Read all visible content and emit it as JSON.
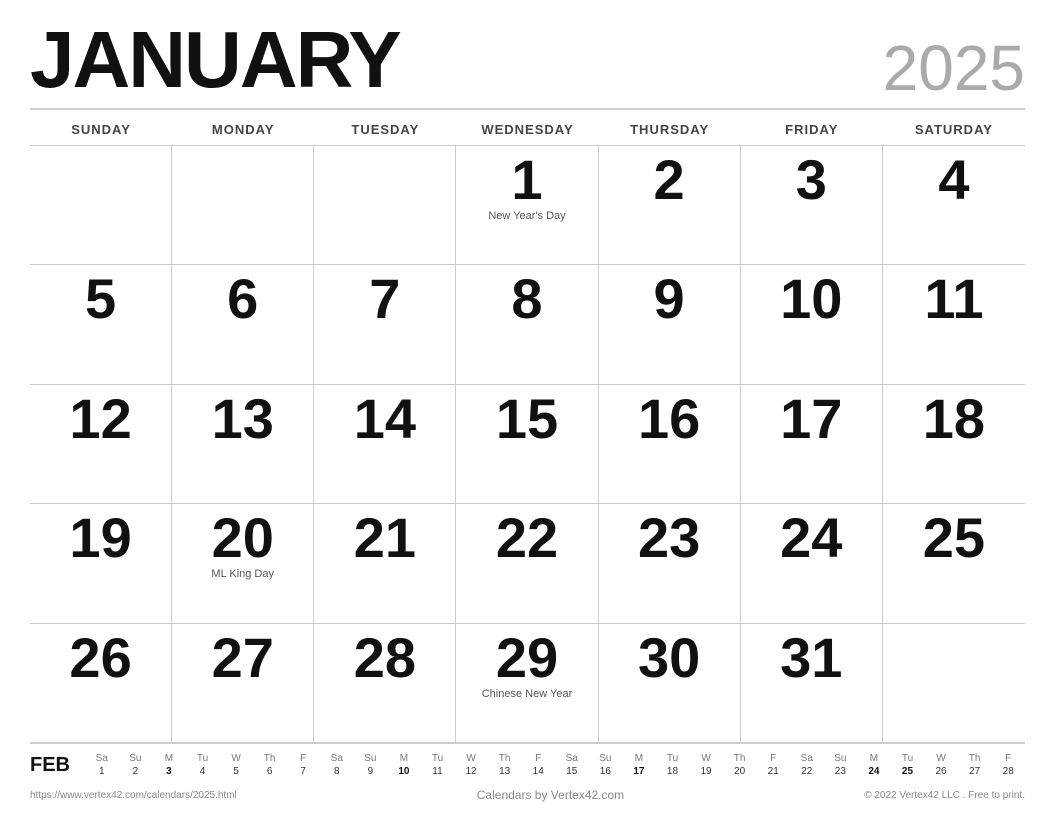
{
  "header": {
    "month": "JANUARY",
    "year": "2025"
  },
  "day_names": [
    "SUNDAY",
    "MONDAY",
    "TUESDAY",
    "WEDNESDAY",
    "THURSDAY",
    "FRIDAY",
    "SATURDAY"
  ],
  "weeks": [
    [
      {
        "date": "",
        "holiday": ""
      },
      {
        "date": "",
        "holiday": ""
      },
      {
        "date": "",
        "holiday": ""
      },
      {
        "date": "1",
        "holiday": "New Year's Day"
      },
      {
        "date": "2",
        "holiday": ""
      },
      {
        "date": "3",
        "holiday": ""
      },
      {
        "date": "4",
        "holiday": ""
      }
    ],
    [
      {
        "date": "5",
        "holiday": ""
      },
      {
        "date": "6",
        "holiday": ""
      },
      {
        "date": "7",
        "holiday": ""
      },
      {
        "date": "8",
        "holiday": ""
      },
      {
        "date": "9",
        "holiday": ""
      },
      {
        "date": "10",
        "holiday": ""
      },
      {
        "date": "11",
        "holiday": ""
      }
    ],
    [
      {
        "date": "12",
        "holiday": ""
      },
      {
        "date": "13",
        "holiday": ""
      },
      {
        "date": "14",
        "holiday": ""
      },
      {
        "date": "15",
        "holiday": ""
      },
      {
        "date": "16",
        "holiday": ""
      },
      {
        "date": "17",
        "holiday": ""
      },
      {
        "date": "18",
        "holiday": ""
      }
    ],
    [
      {
        "date": "19",
        "holiday": ""
      },
      {
        "date": "20",
        "holiday": "ML King Day"
      },
      {
        "date": "21",
        "holiday": ""
      },
      {
        "date": "22",
        "holiday": ""
      },
      {
        "date": "23",
        "holiday": ""
      },
      {
        "date": "24",
        "holiday": ""
      },
      {
        "date": "25",
        "holiday": ""
      }
    ],
    [
      {
        "date": "26",
        "holiday": ""
      },
      {
        "date": "27",
        "holiday": ""
      },
      {
        "date": "28",
        "holiday": ""
      },
      {
        "date": "29",
        "holiday": "Chinese New Year"
      },
      {
        "date": "30",
        "holiday": ""
      },
      {
        "date": "31",
        "holiday": ""
      },
      {
        "date": "",
        "holiday": ""
      }
    ]
  ],
  "mini_calendar": {
    "month_label": "FEB",
    "day_names": [
      "Sa",
      "Su",
      "M",
      "Tu",
      "W",
      "Th",
      "F",
      "Sa",
      "Su",
      "M",
      "Tu",
      "W",
      "Th",
      "F",
      "Sa",
      "Su",
      "M",
      "Tu",
      "W",
      "Th",
      "F",
      "Sa",
      "Su",
      "M",
      "Tu",
      "W",
      "Th",
      "F"
    ],
    "days": [
      "1",
      "2",
      "3",
      "4",
      "5",
      "6",
      "7",
      "8",
      "9",
      "10",
      "11",
      "12",
      "13",
      "14",
      "15",
      "16",
      "17",
      "18",
      "19",
      "20",
      "21",
      "22",
      "23",
      "24",
      "25",
      "26",
      "27",
      "28"
    ],
    "bold_days": [
      "3",
      "10",
      "17",
      "24",
      "25"
    ]
  },
  "footer": {
    "left": "https://www.vertex42.com/calendars/2025.html",
    "center": "Calendars by Vertex42.com",
    "right": "© 2022 Vertex42 LLC . Free to print."
  }
}
